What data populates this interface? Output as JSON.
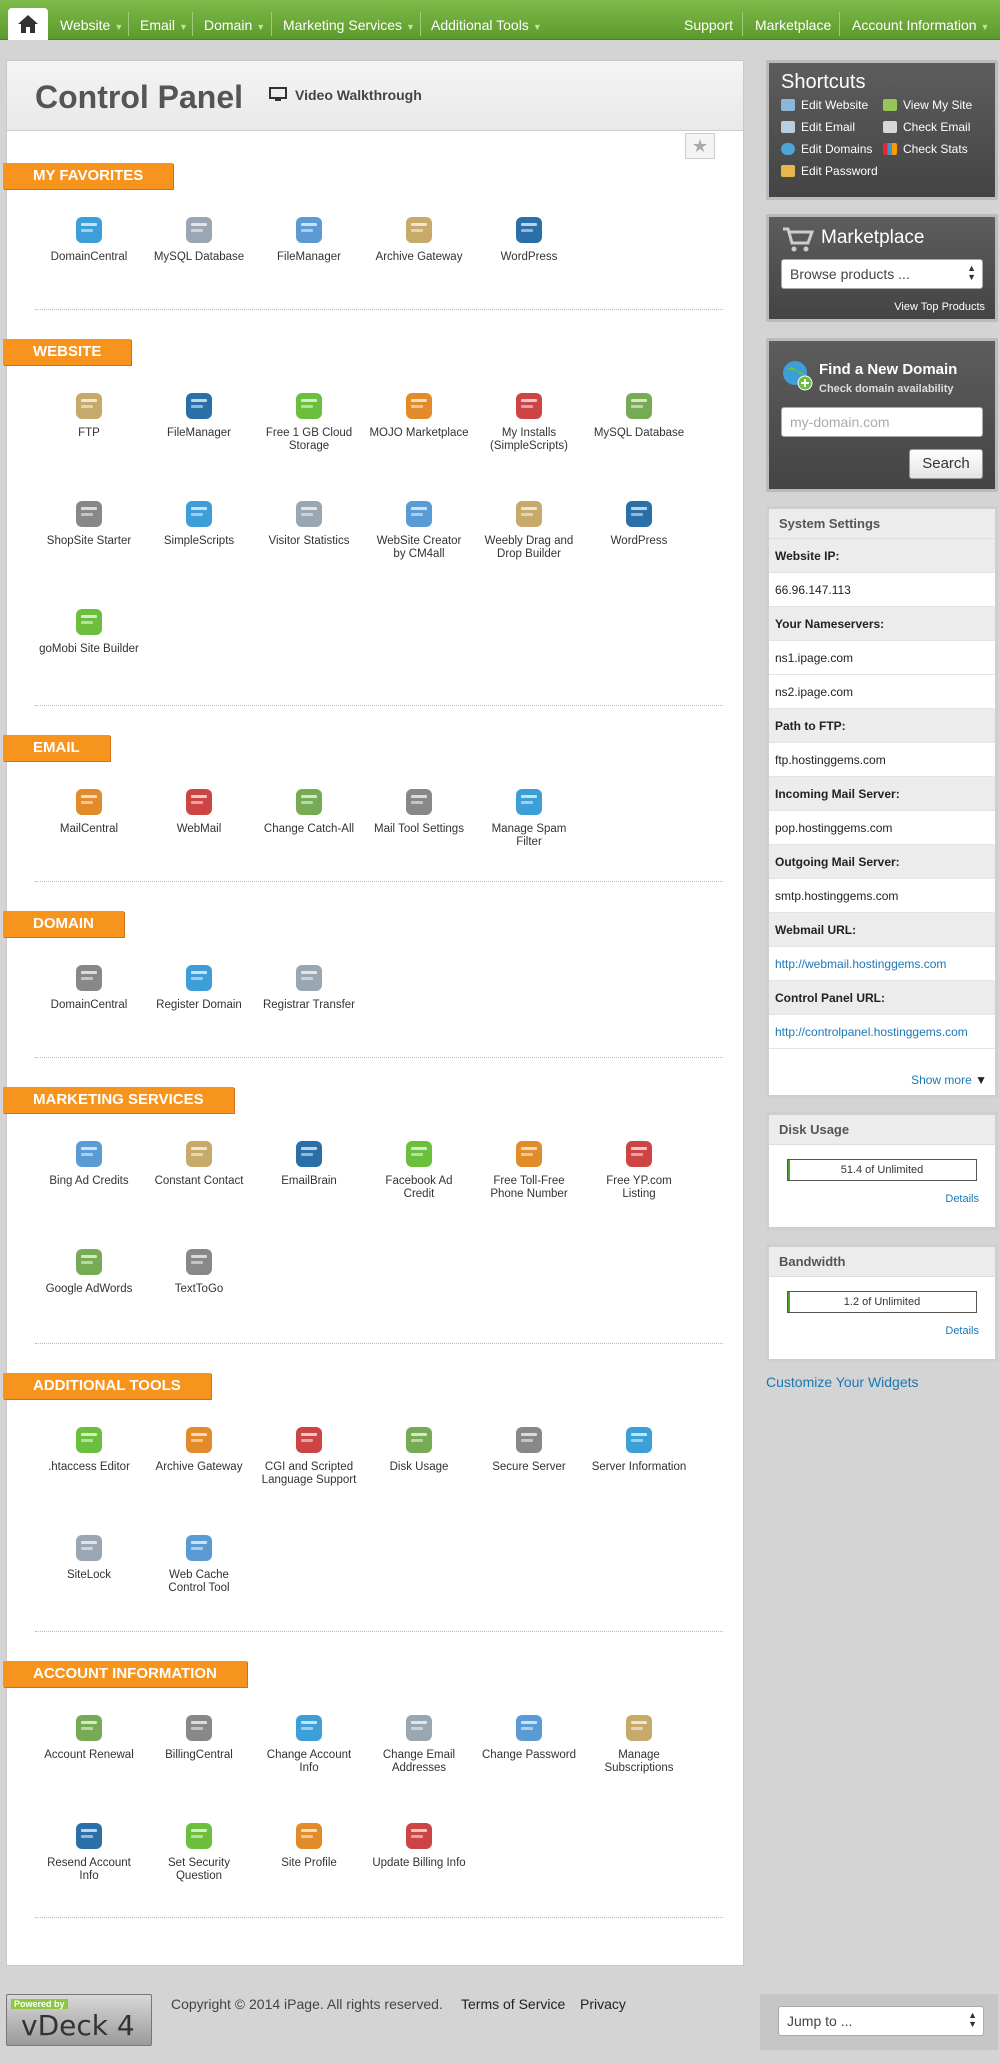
{
  "nav": {
    "items": [
      {
        "label": "Website",
        "caret": "▼"
      },
      {
        "label": "Email",
        "caret": "▼"
      },
      {
        "label": "Domain",
        "caret": "▼"
      },
      {
        "label": "Marketing Services",
        "caret": "▼"
      },
      {
        "label": "Additional Tools",
        "caret": "▼"
      },
      {
        "label": "Support"
      },
      {
        "label": "Marketplace"
      },
      {
        "label": "Account Information",
        "caret": "▼"
      }
    ]
  },
  "header": {
    "title": "Control Panel",
    "walkthrough": "Video Walkthrough"
  },
  "sections": [
    {
      "label": "MY FAVORITES",
      "items": [
        "DomainCentral",
        "MySQL Database",
        "FileManager",
        "Archive Gateway",
        "WordPress"
      ]
    },
    {
      "label": "WEBSITE",
      "items": [
        "FTP",
        "FileManager",
        "Free 1 GB Cloud Storage",
        "MOJO Marketplace",
        "My Installs (SimpleScripts)",
        "MySQL Database",
        "ShopSite Starter",
        "SimpleScripts",
        "Visitor Statistics",
        "WebSite Creator by CM4all",
        "Weebly Drag and Drop Builder",
        "WordPress",
        "goMobi Site Builder"
      ]
    },
    {
      "label": "EMAIL",
      "items": [
        "MailCentral",
        "WebMail",
        "Change Catch-All",
        "Mail Tool Settings",
        "Manage Spam Filter"
      ]
    },
    {
      "label": "DOMAIN",
      "items": [
        "DomainCentral",
        "Register Domain",
        "Registrar Transfer"
      ]
    },
    {
      "label": "MARKETING SERVICES",
      "items": [
        "Bing Ad Credits",
        "Constant Contact",
        "EmailBrain",
        "Facebook Ad Credit",
        "Free Toll-Free Phone Number",
        "Free YP.com Listing",
        "Google AdWords",
        "TextToGo"
      ]
    },
    {
      "label": "ADDITIONAL TOOLS",
      "items": [
        ".htaccess Editor",
        "Archive Gateway",
        "CGI and Scripted Language Support",
        "Disk Usage",
        "Secure Server",
        "Server Information",
        "SiteLock",
        "Web Cache Control Tool"
      ]
    },
    {
      "label": "ACCOUNT INFORMATION",
      "items": [
        "Account Renewal",
        "BillingCentral",
        "Change Account Info",
        "Change Email Addresses",
        "Change Password",
        "Manage Subscriptions",
        "Resend Account Info",
        "Set Security Question",
        "Site Profile",
        "Update Billing Info"
      ]
    }
  ],
  "shortcuts": {
    "title": "Shortcuts",
    "items": [
      "Edit Website",
      "View My Site",
      "Edit Email",
      "Check Email",
      "Edit Domains",
      "Check Stats",
      "Edit Password"
    ]
  },
  "marketplace": {
    "title": "Marketplace",
    "select": "Browse products ...",
    "link": "View Top Products"
  },
  "find_domain": {
    "title": "Find a New Domain",
    "subtitle": "Check domain availability",
    "placeholder": "my-domain.com",
    "button": "Search"
  },
  "system_settings": {
    "title": "System Settings",
    "rows": [
      {
        "k": "Website IP:",
        "v": [
          "66.96.147.113"
        ]
      },
      {
        "k": "Your Nameservers:",
        "v": [
          "ns1.ipage.com",
          "ns2.ipage.com"
        ]
      },
      {
        "k": "Path to FTP:",
        "v": [
          "ftp.hostinggems.com"
        ]
      },
      {
        "k": "Incoming Mail Server:",
        "v": [
          "pop.hostinggems.com"
        ]
      },
      {
        "k": "Outgoing Mail Server:",
        "v": [
          "smtp.hostinggems.com"
        ]
      },
      {
        "k": "Webmail URL:",
        "v": [
          "http://webmail.hostinggems.com"
        ],
        "link": true
      },
      {
        "k": "Control Panel URL:",
        "v": [
          "http://controlpanel.hostinggems.com"
        ],
        "link": true
      }
    ],
    "show_more": "Show more"
  },
  "disk_usage": {
    "title": "Disk Usage",
    "value": "51.4 of Unlimited",
    "fill_pct": 1,
    "details": "Details"
  },
  "bandwidth": {
    "title": "Bandwidth",
    "value": "1.2 of Unlimited",
    "fill_pct": 1,
    "details": "Details"
  },
  "customize": "Customize Your Widgets",
  "footer": {
    "powered_by": "Powered by",
    "vdeck": "vDeck 4",
    "copyright": "Copyright © 2014  iPage. All rights reserved.",
    "terms": "Terms of Service",
    "privacy": "Privacy",
    "jump": "Jump to ..."
  },
  "colors": {
    "nav_green": "#6aa935",
    "section_orange": "#f7941e",
    "link_blue": "#1a79b5"
  }
}
